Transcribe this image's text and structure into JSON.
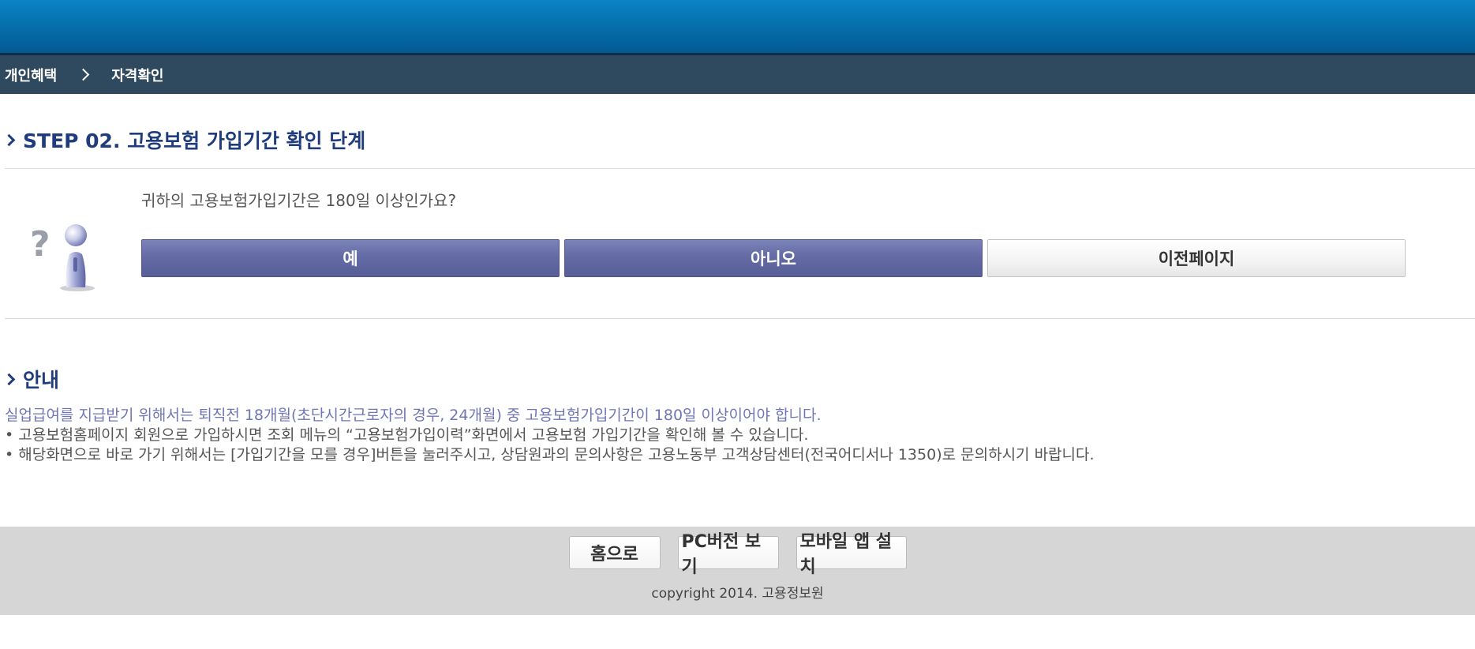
{
  "breadcrumb": {
    "items": [
      "개인혜택",
      "자격확인"
    ]
  },
  "step": {
    "title": "STEP 02. 고용보험 가입기간 확인 단계",
    "question": "귀하의 고용보험가입기간은 180일 이상인가요?",
    "buttons": {
      "yes": "예",
      "no": "아니오",
      "previous": "이전페이지"
    }
  },
  "notice": {
    "title": "안내",
    "lead": "실업급여를 지급받기 위해서는 퇴직전 18개월(초단시간근로자의 경우, 24개월) 중 고용보험가입기간이 180일 이상이어야 합니다.",
    "bullets": [
      "• 고용보험홈페이지 회원으로 가입하시면 조회 메뉴의 “고용보험가입이력”화면에서 고용보험 가입기간을 확인해 볼 수 있습니다.",
      "• 해당화면으로 바로 가기 위해서는 [가입기간을 모를 경우]버튼을 눌러주시고, 상담원과의 문의사항은 고용노동부 고객상담센터(전국어디서나 1350)로 문의하시기 바랍니다."
    ]
  },
  "footer": {
    "home": "홈으로",
    "pc_version": "PC버전 보기",
    "mobile_app": "모바일 앱 설치",
    "copyright": "copyright 2014. 고용정보원"
  },
  "icons": {
    "question_icon": "question-person-icon",
    "breadcrumb_separator": "chevron-right-icon",
    "section_marker": "chevron-right-icon"
  },
  "colors": {
    "banner": "#0671ad",
    "breadcrumb_bar": "#2f4a5e",
    "title": "#1f3c7c",
    "primary_button": "#6269a3",
    "highlight_text": "#6f76b4",
    "footer": "#d6d6d6"
  }
}
